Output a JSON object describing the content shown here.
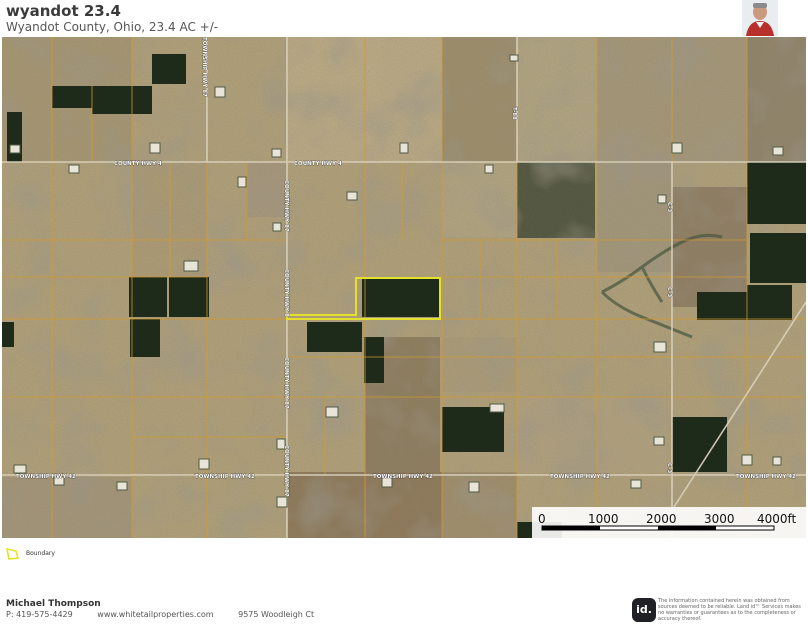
{
  "header": {
    "title": "wyandot 23.4",
    "subtitle": "Wyandot County, Ohio, 23.4 AC +/-"
  },
  "map": {
    "road_labels": {
      "county_hwy_4_west": "COUNTY HWY 4",
      "county_hwy_4_center": "COUNTY HWY 4",
      "county_hwy_87_upper": "COUNTY HWY 87",
      "county_hwy_8_mid": "COUNTY HWY 8",
      "county_hwy_87_lower": "COUNTY HWY 87",
      "county_hwy_87_bottom": "COUNTY HWY 87",
      "township_hwy_87_top": "TOWNSHIP HWY 87",
      "township_hwy_42_far_west": "TOWNSHIP HWY 42",
      "township_hwy_42_west": "TOWNSHIP HWY 42",
      "township_hwy_42_center": "TOWNSHIP HWY 42",
      "township_hwy_42_east": "TOWNSHIP HWY 42",
      "township_hwy_42_far_east": "TOWNSHIP HWY 42",
      "t88": "T-88",
      "c3_upper": "C-3",
      "c3_mid": "C-3",
      "c3_lower": "C-3"
    },
    "boundary_color": "#e3e12b",
    "parcel_line_color": "#d79a2a",
    "scalebar": {
      "ticks": [
        "0",
        "1000",
        "2000",
        "3000",
        "4000ft"
      ],
      "unit": "ft"
    }
  },
  "legend": {
    "icon": "boundary-polygon-icon",
    "label": "Boundary"
  },
  "footer": {
    "name": "Michael Thompson",
    "phone": "P: 419-575-4429",
    "website": "www.whitetailproperties.com",
    "address": "9575 Woodleigh Ct",
    "logo_text": "id.",
    "disclaimer": "The information contained herein was obtained from sources deemed to be reliable. Land id™ Services makes no warranties or guarantees as to the completeness or accuracy thereof."
  }
}
